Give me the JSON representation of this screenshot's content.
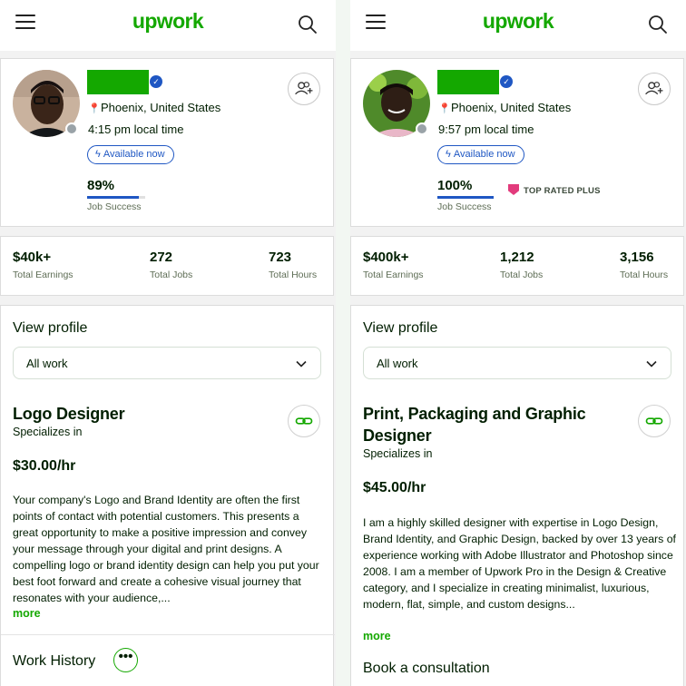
{
  "brand": {
    "logo_text": "upwork",
    "accent": "#14a800",
    "link_blue": "#1f57c3"
  },
  "left": {
    "location": "Phoenix, United States",
    "local_time": "4:15 pm local time",
    "availability": "Available now",
    "job_success": {
      "value": "89%",
      "label": "Job Success",
      "fraction": 0.89
    },
    "stats": [
      {
        "value": "$40k+",
        "label": "Total Earnings"
      },
      {
        "value": "272",
        "label": "Total Jobs"
      },
      {
        "value": "723",
        "label": "Total Hours"
      }
    ],
    "view_profile": "View profile",
    "select_value": "All work",
    "title": "Logo Designer",
    "specializes": "Specializes in",
    "rate": "$30.00/hr",
    "description": "Your company's Logo and Brand Identity are often the first points of contact with potential customers. This presents a great opportunity to make a positive impression and convey your message through your digital and print designs. A compelling logo or brand identity design can help you put your best foot forward and create a cohesive visual journey that resonates with your audience,...",
    "more": "more",
    "work_history": "Work History",
    "dots": "•••"
  },
  "right": {
    "location": "Phoenix, United States",
    "local_time": "9:57 pm local time",
    "availability": "Available now",
    "job_success": {
      "value": "100%",
      "label": "Job Success",
      "fraction": 1.0
    },
    "badge": "TOP RATED PLUS",
    "stats": [
      {
        "value": "$400k+",
        "label": "Total Earnings"
      },
      {
        "value": "1,212",
        "label": "Total Jobs"
      },
      {
        "value": "3,156",
        "label": "Total Hours"
      }
    ],
    "view_profile": "View profile",
    "select_value": "All work",
    "title": "Print, Packaging and Graphic Designer",
    "specializes": "Specializes in",
    "rate": "$45.00/hr",
    "description": "I am a highly skilled designer with expertise in Logo Design, Brand Identity, and Graphic Design, backed by over 13 years of experience working with Adobe Illustrator and Photoshop since 2008. I am a member of Upwork Pro in the Design & Creative category, and I specialize in creating minimalist, luxurious, modern, flat, simple, and custom designs...",
    "more": "more",
    "book": "Book a consultation"
  }
}
